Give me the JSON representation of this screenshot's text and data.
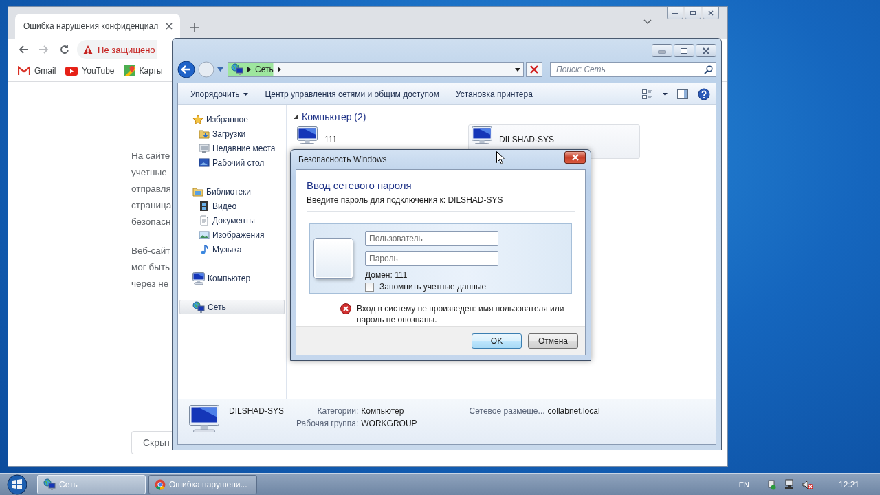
{
  "chrome": {
    "tabs": [
      {
        "title": "Ошибка нарушения конфиденциал",
        "selected": true
      }
    ],
    "security_label": "Не защищено",
    "bookmarks": [
      {
        "label": "Gmail",
        "kind": "gmail"
      },
      {
        "label": "YouTube",
        "kind": "youtube"
      },
      {
        "label": "Карты",
        "kind": "maps"
      }
    ],
    "paragraphs": [
      [
        "На сайте",
        "учетные",
        "отправля",
        "страница",
        "безопасн"
      ],
      [
        "Веб-сайт",
        "мог быть",
        "через не"
      ]
    ],
    "button": "Скрыт"
  },
  "explorer": {
    "address": {
      "crumb": "Сеть"
    },
    "search": {
      "placeholder": "Поиск: Сеть"
    },
    "toolbar": [
      {
        "label": "Упорядочить",
        "dropdown": true
      },
      {
        "label": "Центр управления сетями и общим доступом",
        "dropdown": false
      },
      {
        "label": "Установка принтера",
        "dropdown": false
      }
    ],
    "nav": [
      {
        "label": "Избранное",
        "kind": "star",
        "selected": false,
        "children": [
          {
            "label": "Загрузки",
            "kind": "downloads",
            "selected": false
          },
          {
            "label": "Недавние места",
            "kind": "recent",
            "selected": false
          },
          {
            "label": "Рабочий стол",
            "kind": "desktop",
            "selected": false
          }
        ]
      },
      {
        "label": "Библиотеки",
        "kind": "libraries",
        "selected": false,
        "children": [
          {
            "label": "Видео",
            "kind": "video",
            "selected": false
          },
          {
            "label": "Документы",
            "kind": "documents",
            "selected": false
          },
          {
            "label": "Изображения",
            "kind": "pictures",
            "selected": false
          },
          {
            "label": "Музыка",
            "kind": "music",
            "selected": false
          }
        ]
      },
      {
        "label": "Компьютер",
        "kind": "computer",
        "selected": false
      },
      {
        "label": "Сеть",
        "kind": "network",
        "selected": true
      }
    ],
    "group": {
      "title": "Компьютер (2)",
      "expanded": true
    },
    "items": [
      {
        "label": "111",
        "selected": false
      },
      {
        "label": "DILSHAD-SYS",
        "selected": true
      }
    ],
    "details": {
      "name": "DILSHAD-SYS",
      "fields": [
        {
          "label": "Категории:",
          "value": "Компьютер"
        },
        {
          "label": "Рабочая группа:",
          "value": "WORKGROUP"
        },
        {
          "label": "Сетевое размеще...",
          "value": "collabnet.local"
        }
      ]
    }
  },
  "dialog": {
    "title": "Безопасность Windows",
    "heading": "Ввод сетевого пароля",
    "subtitle": "Введите пароль для подключения к: DILSHAD-SYS",
    "username": {
      "placeholder": "Пользователь"
    },
    "password": {
      "placeholder": "Пароль"
    },
    "domain": "Домен: 111",
    "remember": {
      "label": "Запомнить учетные данные",
      "checked": false
    },
    "error": "Вход в систему не произведен: имя пользователя или пароль не опознаны.",
    "buttons": [
      {
        "label": "OK",
        "default": true
      },
      {
        "label": "Отмена",
        "default": false
      }
    ]
  },
  "taskbar": {
    "buttons": [
      {
        "label": "Сеть",
        "kind": "explorer",
        "selected": true
      },
      {
        "label": "Ошибка нарушени...",
        "kind": "chrome",
        "selected": false
      }
    ],
    "language": "EN",
    "time": "12:21"
  }
}
